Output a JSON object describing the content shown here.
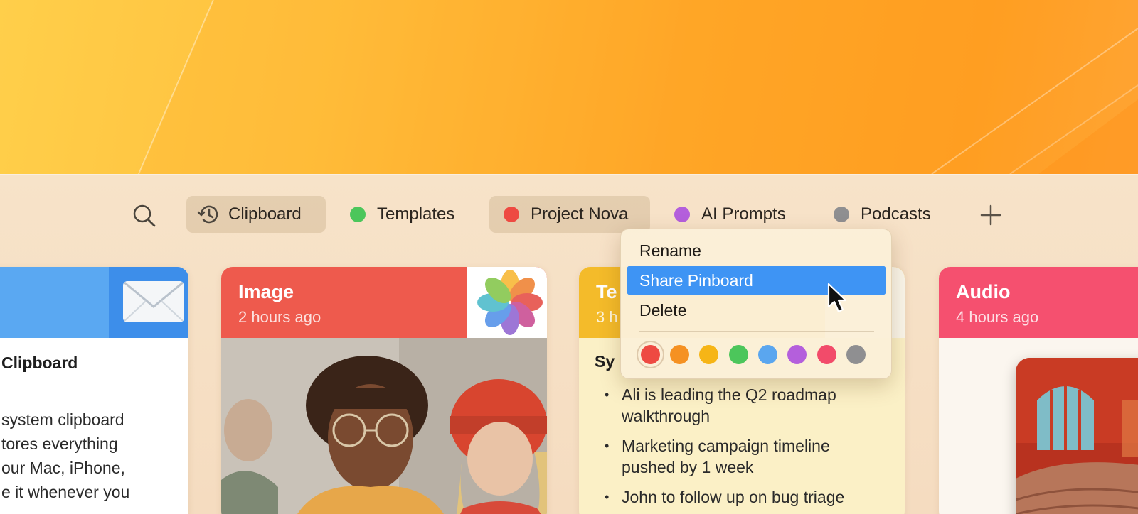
{
  "toolbar": {
    "tabs": [
      {
        "label": "Clipboard",
        "active": true
      },
      {
        "label": "Templates",
        "color": "#4cc65b"
      },
      {
        "label": "Project Nova",
        "color": "#ee4a42",
        "active": true
      },
      {
        "label": "AI Prompts",
        "color": "#b45fdc"
      },
      {
        "label": "Podcasts",
        "color": "#8f8f91"
      }
    ]
  },
  "cards": {
    "text": {
      "body_title": "Clipboard",
      "body_lines": [
        "system clipboard",
        "tores everything",
        "our Mac, iPhone,",
        "e it whenever you"
      ]
    },
    "image": {
      "title": "Image",
      "time": "2 hours ago"
    },
    "note": {
      "title": "Te",
      "time": "3 h",
      "heading": "Sy",
      "bullets": [
        "Ali is leading the Q2 roadmap walkthrough",
        "Marketing campaign timeline pushed by 1 week",
        "John to follow up on bug triage"
      ]
    },
    "audio": {
      "title": "Audio",
      "time": "4 hours ago"
    }
  },
  "context_menu": {
    "items": [
      {
        "label": "Rename"
      },
      {
        "label": "Share Pinboard",
        "highlighted": true
      },
      {
        "label": "Delete"
      }
    ],
    "colors": [
      "#ee4a42",
      "#f59122",
      "#f6b516",
      "#4cc65b",
      "#5aa6ef",
      "#b45fdc",
      "#f24b6a",
      "#8f8f91"
    ],
    "selected_color": "#ee4a42"
  },
  "icons": {
    "search": "search-icon",
    "clipboard": "history-clock-icon",
    "add": "plus-icon",
    "mail_app": "mail-envelope-icon",
    "photos_app": "photos-flower-icon",
    "cursor": "mouse-pointer-icon"
  }
}
